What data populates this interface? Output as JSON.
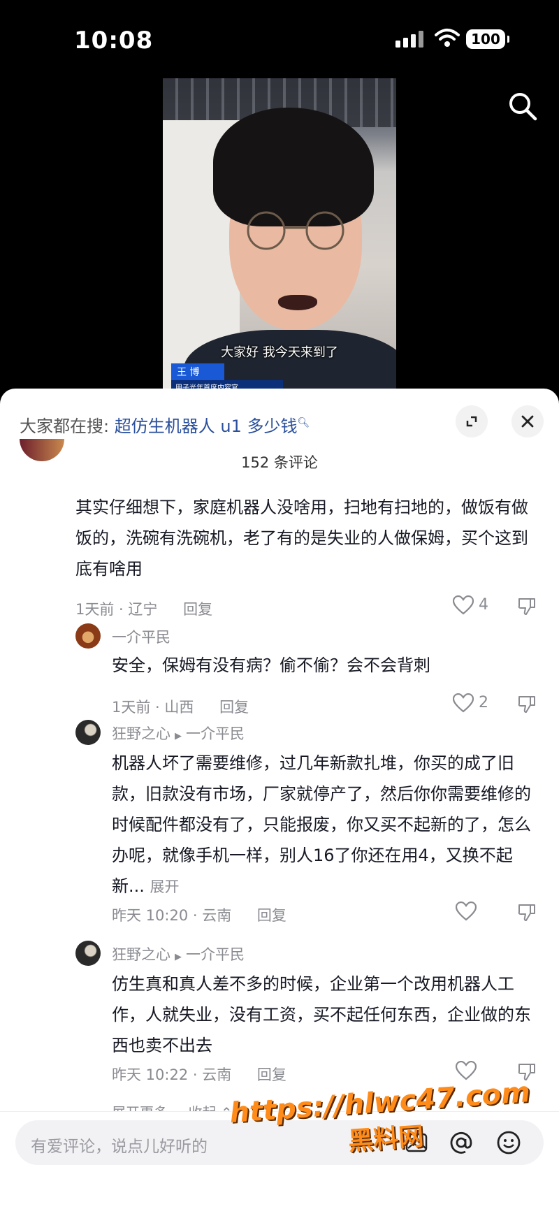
{
  "status_bar": {
    "time": "10:08",
    "battery": "100"
  },
  "video": {
    "subtitle": "大家好 我今天来到了",
    "name_tag": "王 博",
    "name_tag_title": "甲子光年首席内容官"
  },
  "panel": {
    "hot_search_label": "大家都在搜:",
    "hot_search_term": "超仿生机器人 u1 多少钱",
    "comment_count": "152 条评论"
  },
  "comments": [
    {
      "text": "其实仔细想下，家庭机器人没啥用，扫地有扫地的，做饭有做饭的，洗碗有洗碗机，老了有的是失业的人做保姆，买个这到底有啥用",
      "time_location": "1天前 · 辽宁",
      "reply": "回复",
      "likes": "4"
    },
    {
      "user": "一介平民",
      "text": "安全，保姆有没有病？偷不偷？会不会背刺",
      "time_location": "1天前 · 山西",
      "reply": "回复",
      "likes": "2"
    },
    {
      "user": "狂野之心",
      "reply_to": "一介平民",
      "text": "机器人坏了需要维修，过几年新款扎堆，你买的成了旧款，旧款没有市场，厂家就停产了，然后你你需要维修的时候配件都没有了，只能报废，你又买不起新的了，怎么办呢，就像手机一样，别人16了你还在用4，又换不起新...",
      "more": "展开",
      "time_location": "昨天 10:20 · 云南",
      "reply": "回复"
    },
    {
      "user": "狂野之心",
      "reply_to": "一介平民",
      "text": "仿生真和真人差不多的时候，企业第一个改用机器人工作，人就失业，没有工资，买不起任何东西，企业做的东西也卖不出去",
      "time_location": "昨天 10:22 · 云南",
      "reply": "回复"
    }
  ],
  "expand_more": "展开更多 ⌄      收起 ⌃",
  "input_bar": {
    "placeholder": "有爱评论，说点儿好听的"
  },
  "watermark": {
    "line1": "https://hlwc47.com",
    "line2": "黑料网"
  },
  "icons": [
    "search-icon",
    "expand-icon",
    "close-icon",
    "heart-icon",
    "dislike-icon",
    "image-icon",
    "at-icon",
    "emoji-icon"
  ]
}
